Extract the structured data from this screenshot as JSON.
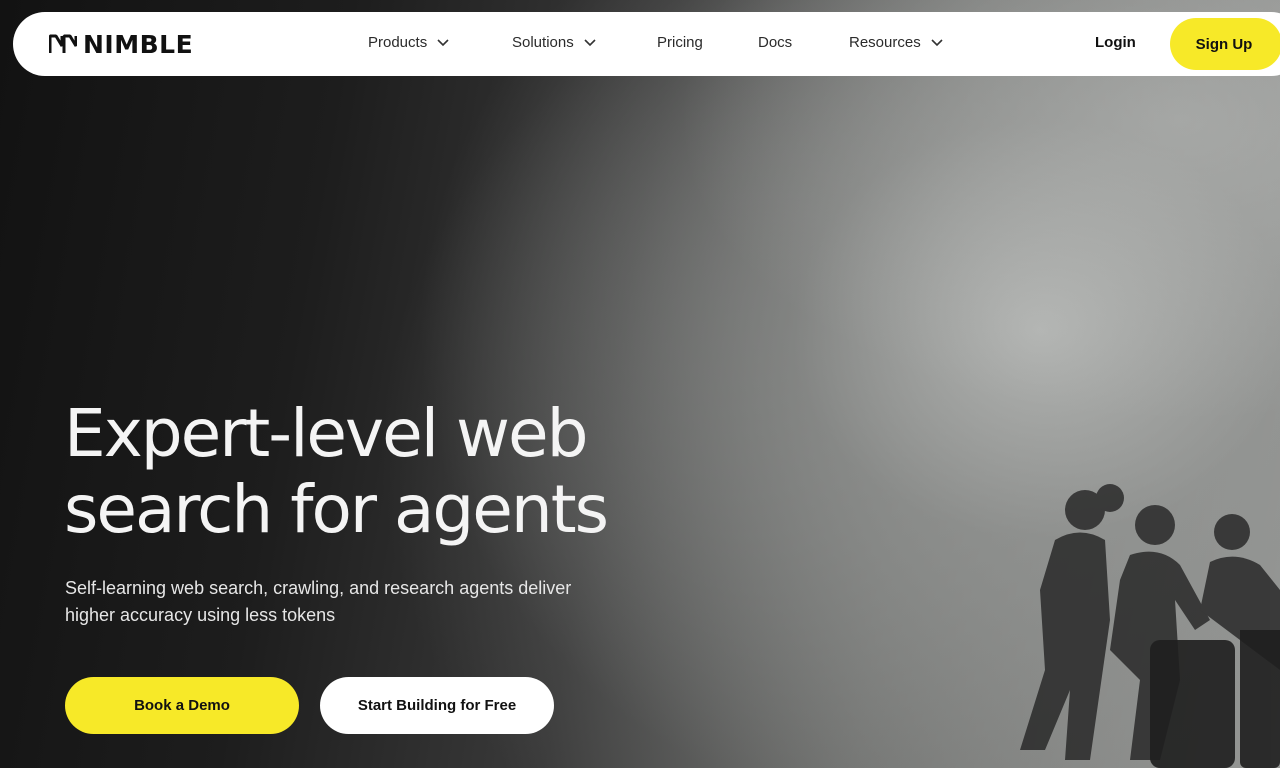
{
  "brand": {
    "name": "NIMBLE",
    "logo_icon": "nimble-logo-icon"
  },
  "nav": {
    "items": [
      {
        "label": "Products",
        "has_dropdown": true
      },
      {
        "label": "Solutions",
        "has_dropdown": true
      },
      {
        "label": "Pricing",
        "has_dropdown": false
      },
      {
        "label": "Docs",
        "has_dropdown": false
      },
      {
        "label": "Resources",
        "has_dropdown": true
      }
    ],
    "login_label": "Login",
    "signup_label": "Sign Up"
  },
  "hero": {
    "headline_line1": "Expert-level web",
    "headline_line2": "search for agents",
    "subline_line1": "Self-learning web search, crawling, and research agents deliver",
    "subline_line2": "higher accuracy using less tokens",
    "primary_cta": "Book a Demo",
    "secondary_cta": "Start Building for Free"
  },
  "colors": {
    "accent": "#f7e928",
    "nav_bg": "#ffffff",
    "hero_dark": "#121212",
    "text_light": "#f4f4f4"
  }
}
